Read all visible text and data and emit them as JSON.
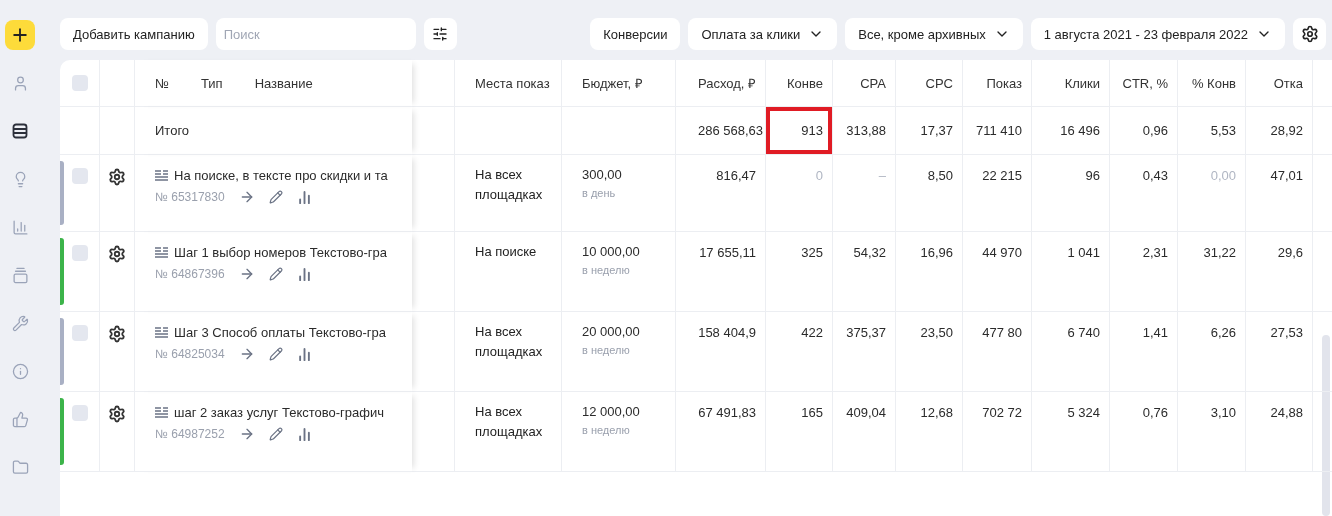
{
  "sidebar": {
    "items": [
      {
        "kind": "user",
        "selected": false
      },
      {
        "kind": "campaigns",
        "selected": true
      },
      {
        "kind": "idea",
        "selected": false
      },
      {
        "kind": "stats",
        "selected": false
      },
      {
        "kind": "layers",
        "selected": false
      },
      {
        "kind": "tools",
        "selected": false
      },
      {
        "kind": "info",
        "selected": false
      },
      {
        "kind": "like",
        "selected": false
      },
      {
        "kind": "folder",
        "selected": false
      }
    ]
  },
  "toolbar": {
    "add_button": "Добавить кампанию",
    "search": {
      "placeholder": "Поиск"
    },
    "filters": [
      {
        "label": "Конверсии",
        "dropdown": false
      },
      {
        "label": "Оплата за клики",
        "dropdown": true
      },
      {
        "label": "Все, кроме архивных",
        "dropdown": true
      },
      {
        "label": "1 августа 2021 - 23 февраля 2022",
        "dropdown": true
      }
    ]
  },
  "table": {
    "header": {
      "checked": false,
      "number": "№",
      "type": "Тип",
      "name": "Название",
      "columns": [
        "Места показ",
        "Бюджет, ₽",
        "Расход, ₽",
        "Конве",
        "CPA",
        "CPC",
        "Показ",
        "Клики",
        "CTR, %",
        "% Конв",
        "Отка"
      ]
    },
    "total": {
      "label": "Итого",
      "cells": [
        {
          "value": "286 568,63",
          "highlighted": false
        },
        {
          "value": "913",
          "highlighted": true
        },
        {
          "value": "313,88",
          "highlighted": false
        },
        {
          "value": "17,37",
          "highlighted": false
        },
        {
          "value": "711 410",
          "highlighted": false
        },
        {
          "value": "16 496",
          "highlighted": false
        },
        {
          "value": "0,96",
          "highlighted": false
        },
        {
          "value": "5,53",
          "highlighted": false
        },
        {
          "value": "28,92",
          "highlighted": false
        }
      ]
    },
    "rows": [
      {
        "color": "#a9b0c4",
        "checked": false,
        "name": "На поиске, в тексте про скидки и та",
        "number": "№ 65317830",
        "places": "На всех площадках",
        "budget": "300,00",
        "budget_period": "в день",
        "metrics": [
          {
            "value": "816,47",
            "muted": false
          },
          {
            "value": "0",
            "muted": true
          },
          {
            "value": "–",
            "muted": true
          },
          {
            "value": "8,50",
            "muted": false
          },
          {
            "value": "22 215",
            "muted": false
          },
          {
            "value": "96",
            "muted": false
          },
          {
            "value": "0,43",
            "muted": false
          },
          {
            "value": "0,00",
            "muted": true
          },
          {
            "value": "47,01",
            "muted": false
          }
        ]
      },
      {
        "color": "#3cb44a",
        "checked": false,
        "name": "Шаг 1 выбор номеров Текстово-гра",
        "number": "№ 64867396",
        "places": "На поиске",
        "budget": "10 000,00",
        "budget_period": "в неделю",
        "metrics": [
          {
            "value": "17 655,11",
            "muted": false
          },
          {
            "value": "325",
            "muted": false
          },
          {
            "value": "54,32",
            "muted": false
          },
          {
            "value": "16,96",
            "muted": false
          },
          {
            "value": "44 970",
            "muted": false
          },
          {
            "value": "1 041",
            "muted": false
          },
          {
            "value": "2,31",
            "muted": false
          },
          {
            "value": "31,22",
            "muted": false
          },
          {
            "value": "29,6",
            "muted": false
          }
        ]
      },
      {
        "color": "#a9b0c4",
        "checked": false,
        "name": "Шаг 3 Способ оплаты Текстово-гра",
        "number": "№ 64825034",
        "places": "На всех площадках",
        "budget": "20 000,00",
        "budget_period": "в неделю",
        "metrics": [
          {
            "value": "158 404,9",
            "muted": false
          },
          {
            "value": "422",
            "muted": false
          },
          {
            "value": "375,37",
            "muted": false
          },
          {
            "value": "23,50",
            "muted": false
          },
          {
            "value": "477 80",
            "muted": false
          },
          {
            "value": "6 740",
            "muted": false
          },
          {
            "value": "1,41",
            "muted": false
          },
          {
            "value": "6,26",
            "muted": false
          },
          {
            "value": "27,53",
            "muted": false
          }
        ]
      },
      {
        "color": "#3cb44a",
        "checked": false,
        "name": "шаг 2 заказ услуг Текстово-графич",
        "number": "№ 64987252",
        "places": "На всех площадках",
        "budget": "12 000,00",
        "budget_period": "в неделю",
        "metrics": [
          {
            "value": "67 491,83",
            "muted": false
          },
          {
            "value": "165",
            "muted": false
          },
          {
            "value": "409,04",
            "muted": false
          },
          {
            "value": "12,68",
            "muted": false
          },
          {
            "value": "702 72",
            "muted": false
          },
          {
            "value": "5 324",
            "muted": false
          },
          {
            "value": "0,76",
            "muted": false
          },
          {
            "value": "3,10",
            "muted": false
          },
          {
            "value": "24,88",
            "muted": false
          }
        ]
      }
    ]
  }
}
